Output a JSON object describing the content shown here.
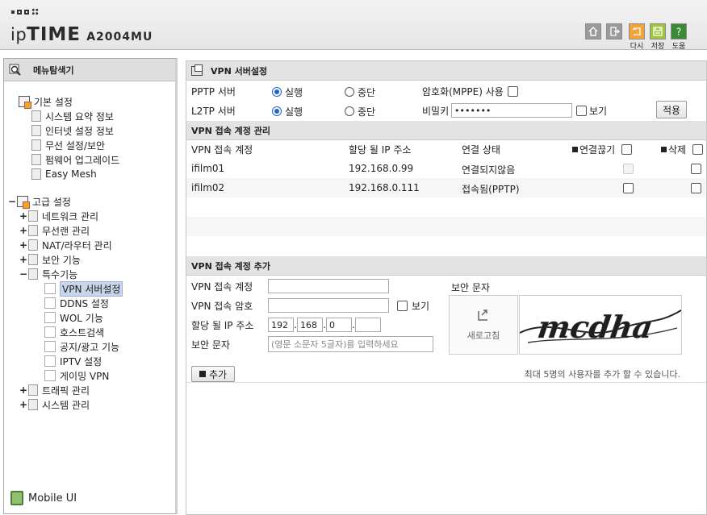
{
  "header": {
    "brand_prefix": "ip",
    "brand_main": "TIME",
    "model": "A2004MU",
    "buttons": [
      {
        "label": "",
        "icon": "home-icon"
      },
      {
        "label": "",
        "icon": "logout-icon"
      },
      {
        "label": "다시",
        "icon": "reload-icon"
      },
      {
        "label": "저장",
        "icon": "save-icon"
      },
      {
        "label": "도움",
        "icon": "help-icon"
      }
    ]
  },
  "sidebar": {
    "title": "메뉴탐색기",
    "basic": {
      "label": "기본 설정",
      "items": [
        "시스템 요약 정보",
        "인터넷 설정 정보",
        "무선 설정/보안",
        "펌웨어 업그레이드",
        "Easy Mesh"
      ]
    },
    "advanced": {
      "label": "고급 설정",
      "groups": [
        "네트워크 관리",
        "무선랜 관리",
        "NAT/라우터 관리",
        "보안 기능",
        "특수기능"
      ],
      "special_items": [
        "VPN 서버설정",
        "DDNS 설정",
        "WOL 기능",
        "호스트검색",
        "공지/광고 기능",
        "IPTV 설정",
        "게이밍 VPN"
      ],
      "more_groups": [
        "트래픽 관리",
        "시스템 관리"
      ]
    },
    "mobile": "Mobile UI"
  },
  "vpn_server": {
    "title": "VPN 서버설정",
    "pptp_label": "PPTP 서버",
    "l2tp_label": "L2TP 서버",
    "run": "실행",
    "stop": "중단",
    "mppe_label": "암호화(MPPE) 사용",
    "secret_label": "비밀키",
    "secret_value": "•••••••",
    "show_label": "보기",
    "apply": "적용"
  },
  "accounts": {
    "title": "VPN 접속 계정 관리",
    "columns": [
      "VPN 접속 계정",
      "할당 될 IP 주소",
      "연결 상태",
      "연결끊기",
      "삭제"
    ],
    "rows": [
      {
        "account": "ifilm01",
        "ip": "192.168.0.99",
        "status": "연결되지않음"
      },
      {
        "account": "ifilm02",
        "ip": "192.168.0.111",
        "status": "접속됨(PPTP)"
      }
    ]
  },
  "add": {
    "title": "VPN 접속 계정 추가",
    "account_label": "VPN 접속 계정",
    "password_label": "VPN 접속 암호",
    "show_label": "보기",
    "ip_label": "할당 될 IP 주소",
    "ip_parts": [
      "192",
      "168",
      "0",
      ""
    ],
    "captcha_label": "보안 문자",
    "captcha_placeholder": "(영문 소문자 5글자)를 입력하세요",
    "captcha_title": "보안 문자",
    "refresh": "새로고침",
    "captcha_text": "mcdha",
    "add_button": "추가",
    "note": "최대 5명의 사용자를 추가 할 수 있습니다."
  }
}
